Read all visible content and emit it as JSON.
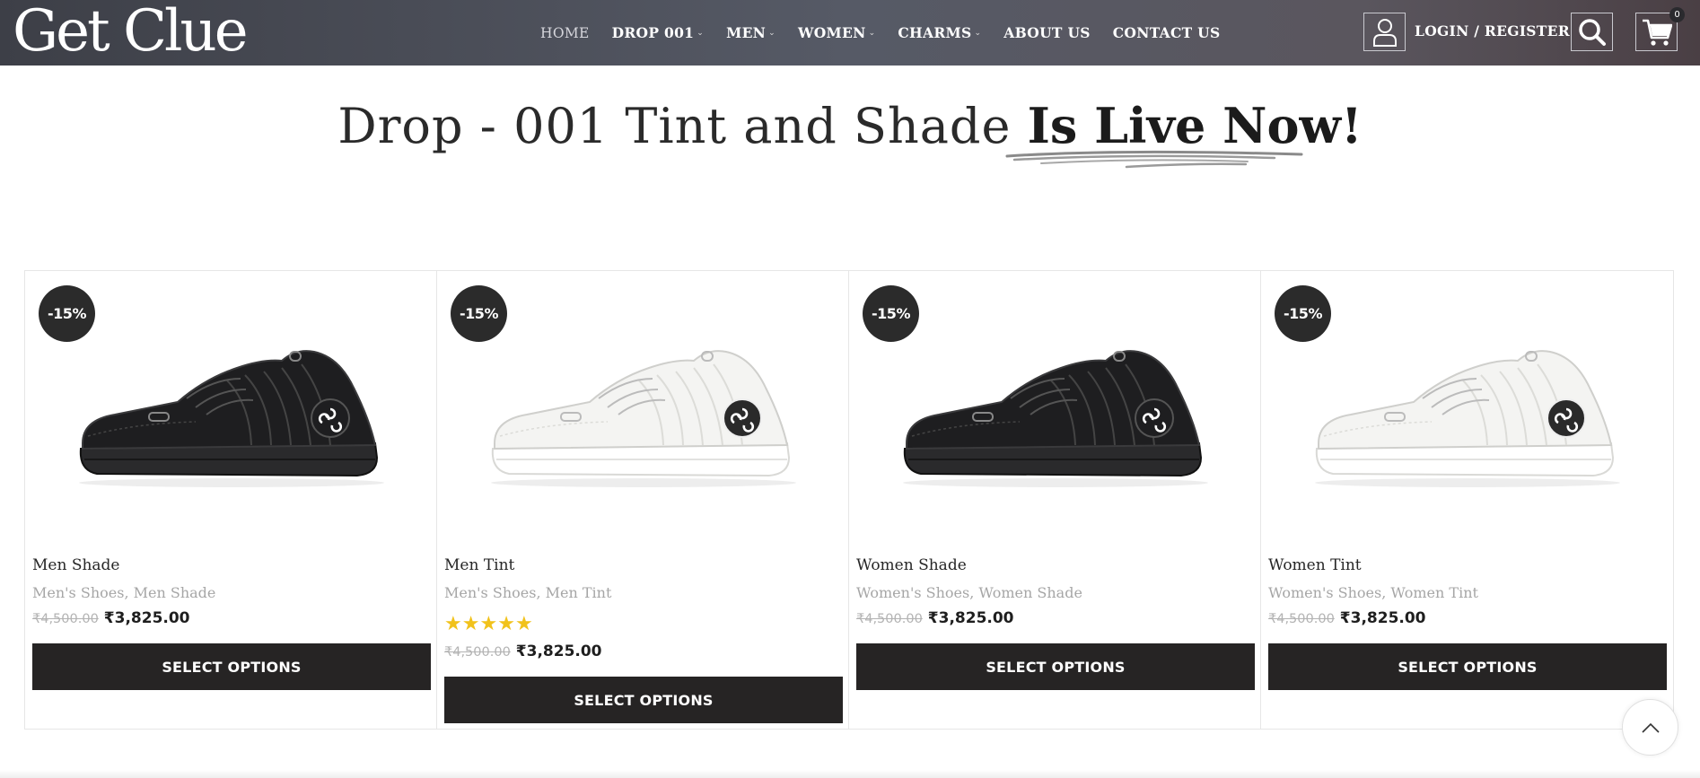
{
  "header": {
    "logo": "Get Clue",
    "nav": [
      {
        "label": "HOME",
        "caret": false,
        "active": true
      },
      {
        "label": "DROP 001",
        "caret": true
      },
      {
        "label": "MEN",
        "caret": true
      },
      {
        "label": "WOMEN",
        "caret": true
      },
      {
        "label": "CHARMS",
        "caret": true
      },
      {
        "label": "ABOUT US",
        "caret": false
      },
      {
        "label": "CONTACT US",
        "caret": false
      }
    ],
    "login_label": "LOGIN / REGISTER",
    "cart_count": "0"
  },
  "headline": {
    "light": "Drop - 001 Tint and Shade ",
    "bold": "Is Live Now!"
  },
  "products": [
    {
      "badge": "-15%",
      "name": "Men Shade",
      "categories": [
        "Men's Shoes",
        "Men Shade"
      ],
      "old_price": "₹4,500.00",
      "price": "₹3,825.00",
      "rating": null,
      "button": "SELECT OPTIONS",
      "shoe_color": "black"
    },
    {
      "badge": "-15%",
      "name": "Men Tint",
      "categories": [
        "Men's Shoes",
        "Men Tint"
      ],
      "old_price": "₹4,500.00",
      "price": "₹3,825.00",
      "rating": 5,
      "button": "SELECT OPTIONS",
      "shoe_color": "white"
    },
    {
      "badge": "-15%",
      "name": "Women Shade",
      "categories": [
        "Women's Shoes",
        "Women Shade"
      ],
      "old_price": "₹4,500.00",
      "price": "₹3,825.00",
      "rating": null,
      "button": "SELECT OPTIONS",
      "shoe_color": "black"
    },
    {
      "badge": "-15%",
      "name": "Women Tint",
      "categories": [
        "Women's Shoes",
        "Women Tint"
      ],
      "old_price": "₹4,500.00",
      "price": "₹3,825.00",
      "rating": null,
      "button": "SELECT OPTIONS",
      "shoe_color": "white"
    }
  ],
  "icons": {
    "user": "user-icon",
    "search": "search-icon",
    "cart": "cart-icon",
    "scroll_top": "chevron-up-icon"
  },
  "colors": {
    "dark": "#262424",
    "star": "#f1c21b"
  }
}
